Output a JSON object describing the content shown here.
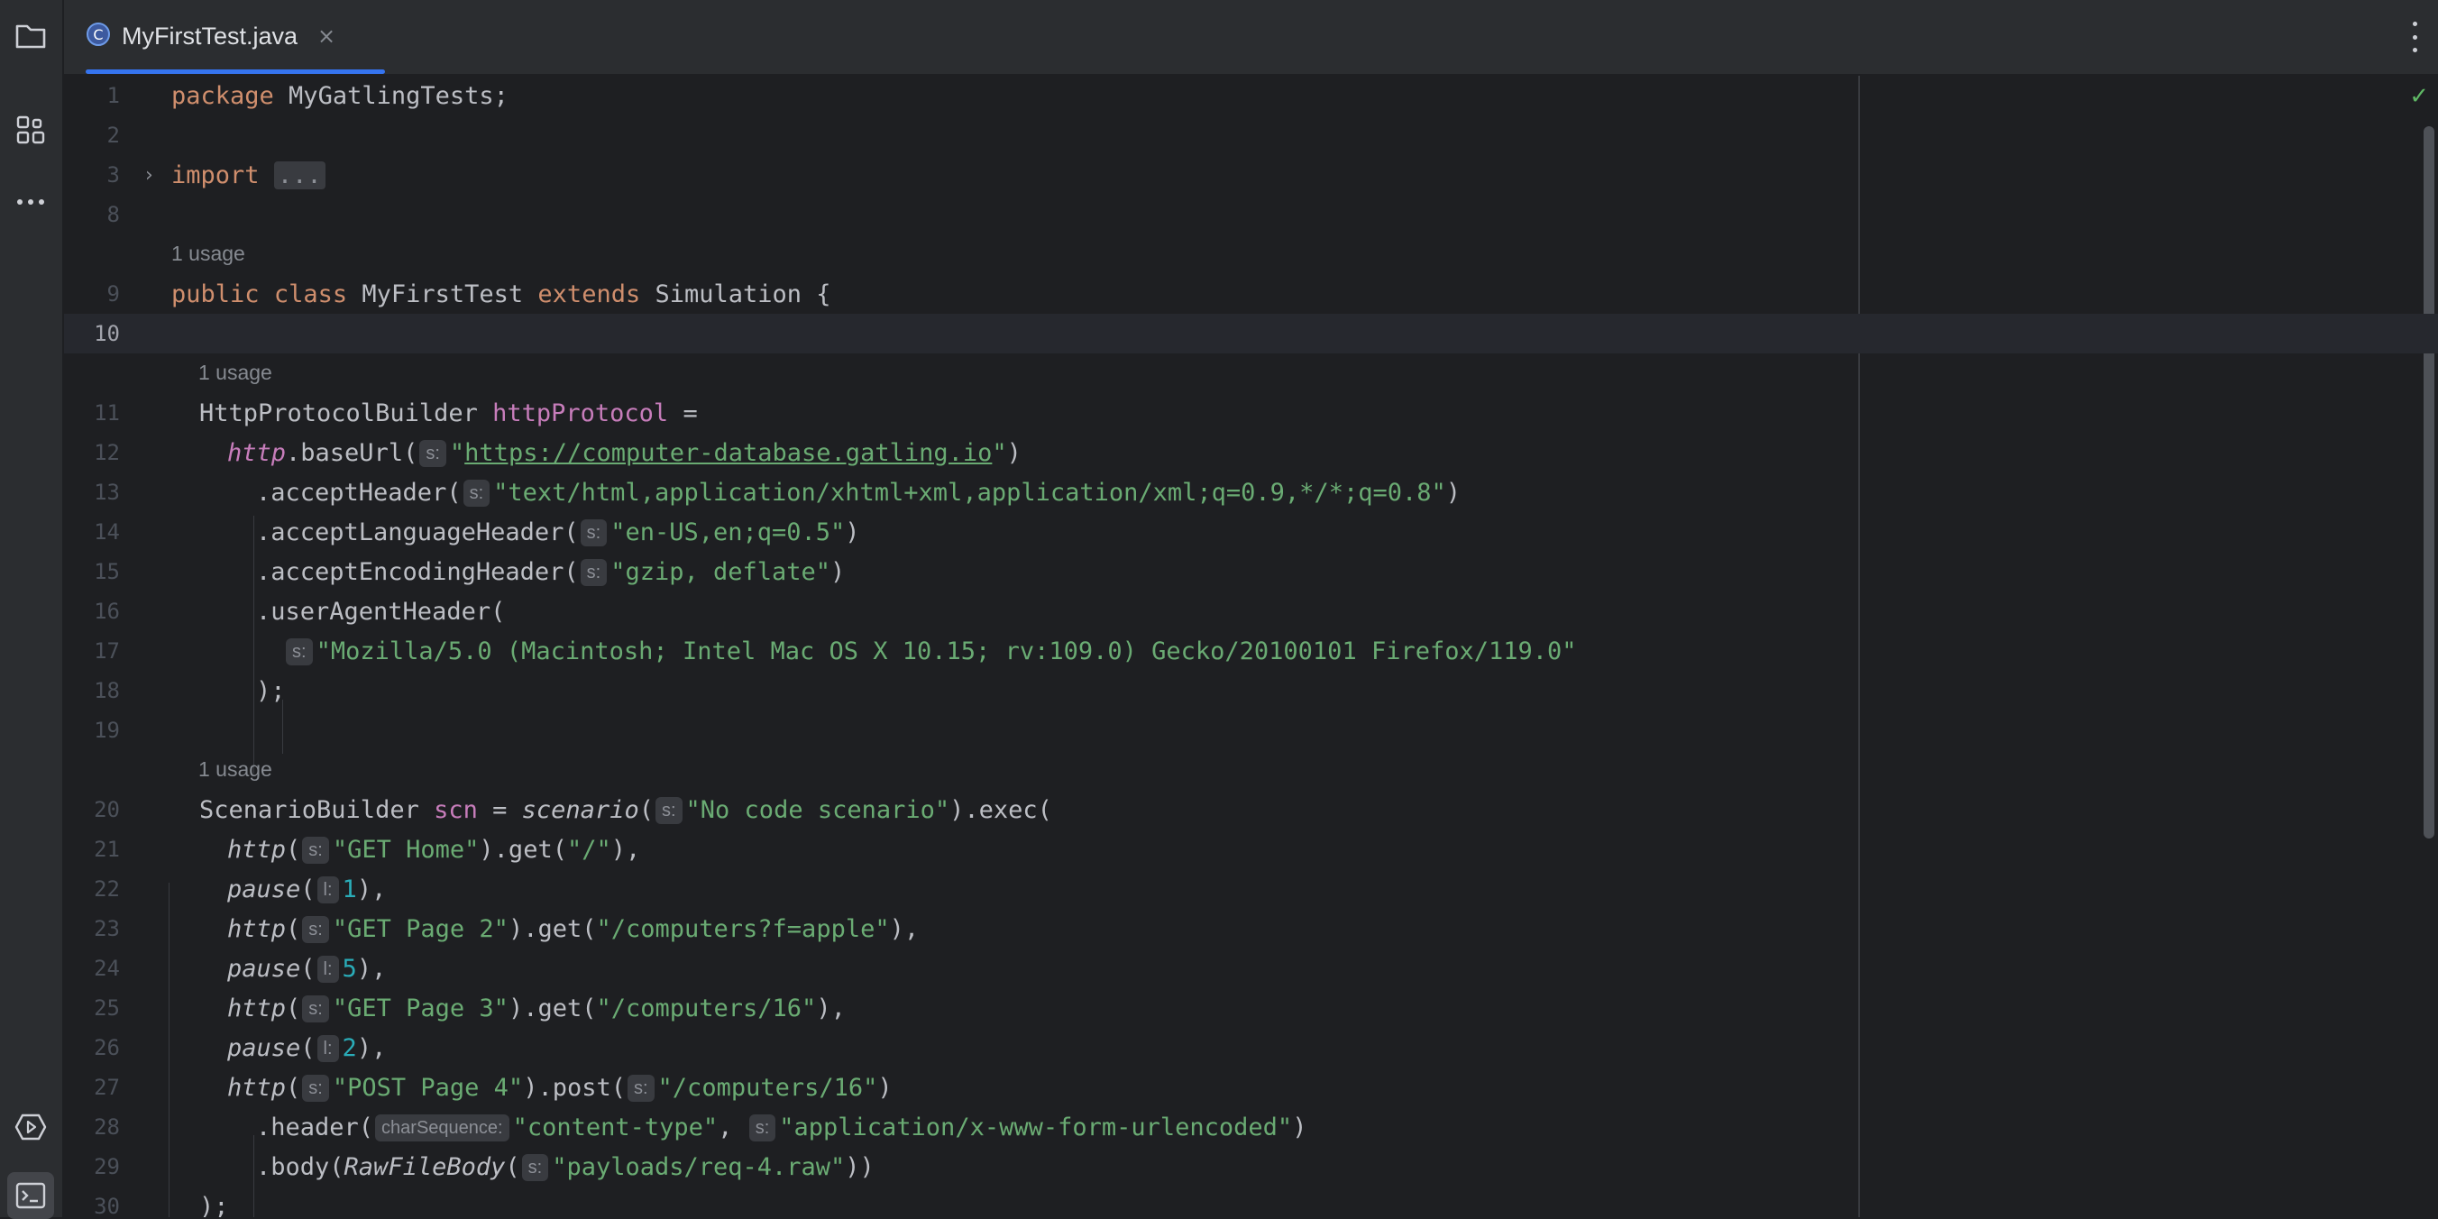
{
  "tab": {
    "title": "MyFirstTest.java",
    "close": "×",
    "icon": "class-icon"
  },
  "sidebar": [
    "folder-icon",
    "structure-icon",
    "more-icon",
    "run-icon",
    "terminal-icon"
  ],
  "usage": "1 usage",
  "lines": {
    "l1": {
      "n": "1",
      "kw": "package",
      "rest": " MyGatlingTests;"
    },
    "l2": {
      "n": "2"
    },
    "l3": {
      "n": "3",
      "kw": "import",
      "fold": "..."
    },
    "l8": {
      "n": "8"
    },
    "l9": {
      "n": "9",
      "kw1": "public",
      "kw2": "class",
      "name": " MyFirstTest ",
      "kw3": "extends",
      "rest": " Simulation {"
    },
    "l10": {
      "n": "10"
    },
    "l11": {
      "n": "11",
      "type": "HttpProtocolBuilder ",
      "field": "httpProtocol",
      "rest": " ="
    },
    "l12": {
      "n": "12",
      "fn": "http",
      "mid": ".baseUrl(",
      "hint": "s:",
      "q1": "\"",
      "url": "https://computer-database.gatling.io",
      "q2": "\"",
      "end": ")"
    },
    "l13": {
      "n": "13",
      "mid": ".acceptHeader(",
      "hint": "s:",
      "str": "\"text/html,application/xhtml+xml,application/xml;q=0.9,*/*;q=0.8\"",
      "end": ")"
    },
    "l14": {
      "n": "14",
      "mid": ".acceptLanguageHeader(",
      "hint": "s:",
      "str": "\"en-US,en;q=0.5\"",
      "end": ")"
    },
    "l15": {
      "n": "15",
      "mid": ".acceptEncodingHeader(",
      "hint": "s:",
      "str": "\"gzip, deflate\"",
      "end": ")"
    },
    "l16": {
      "n": "16",
      "mid": ".userAgentHeader("
    },
    "l17": {
      "n": "17",
      "hint": "s:",
      "str": "\"Mozilla/5.0 (Macintosh; Intel Mac OS X 10.15; rv:109.0) Gecko/20100101 Firefox/119.0\""
    },
    "l18": {
      "n": "18",
      "rest": ");"
    },
    "l19": {
      "n": "19"
    },
    "l20": {
      "n": "20",
      "type": "ScenarioBuilder ",
      "field": "scn",
      "eq": " = ",
      "fn": "scenario",
      "p": "(",
      "hint": "s:",
      "str": "\"No code scenario\"",
      "end": ").exec("
    },
    "l21": {
      "n": "21",
      "fn": "http",
      "p": "(",
      "hint": "s:",
      "str": "\"GET Home\"",
      "mid": ").get(",
      "str2": "\"/\"",
      "end": "),"
    },
    "l22": {
      "n": "22",
      "fn": "pause",
      "p": "(",
      "hint": "l:",
      "num": "1",
      "end": "),"
    },
    "l23": {
      "n": "23",
      "fn": "http",
      "p": "(",
      "hint": "s:",
      "str": "\"GET Page 2\"",
      "mid": ").get(",
      "str2": "\"/computers?f=apple\"",
      "end": "),"
    },
    "l24": {
      "n": "24",
      "fn": "pause",
      "p": "(",
      "hint": "l:",
      "num": "5",
      "end": "),"
    },
    "l25": {
      "n": "25",
      "fn": "http",
      "p": "(",
      "hint": "s:",
      "str": "\"GET Page 3\"",
      "mid": ").get(",
      "str2": "\"/computers/16\"",
      "end": "),"
    },
    "l26": {
      "n": "26",
      "fn": "pause",
      "p": "(",
      "hint": "l:",
      "num": "2",
      "end": "),"
    },
    "l27": {
      "n": "27",
      "fn": "http",
      "p": "(",
      "hint": "s:",
      "str": "\"POST Page 4\"",
      "mid": ").post(",
      "hint2": "s:",
      "str2": "\"/computers/16\"",
      "end": ")"
    },
    "l28": {
      "n": "28",
      "mid": ".header(",
      "hint": "charSequence:",
      "str": "\"content-type\"",
      "comma": ", ",
      "hint2": "s:",
      "str2": "\"application/x-www-form-urlencoded\"",
      "end": ")"
    },
    "l29": {
      "n": "29",
      "mid": ".body(",
      "fn": "RawFileBody",
      "p": "(",
      "hint": "s:",
      "str": "\"payloads/req-4.raw\"",
      "end": "))"
    },
    "l30": {
      "n": "30",
      "rest": ");"
    }
  },
  "colors": {
    "keyword": "#cf8e6d",
    "field": "#c77dbb",
    "string": "#6aab73",
    "number": "#2aacb8",
    "text": "#bcbec4",
    "accent": "#3574f0"
  },
  "status": {
    "inspection": "check-icon"
  }
}
